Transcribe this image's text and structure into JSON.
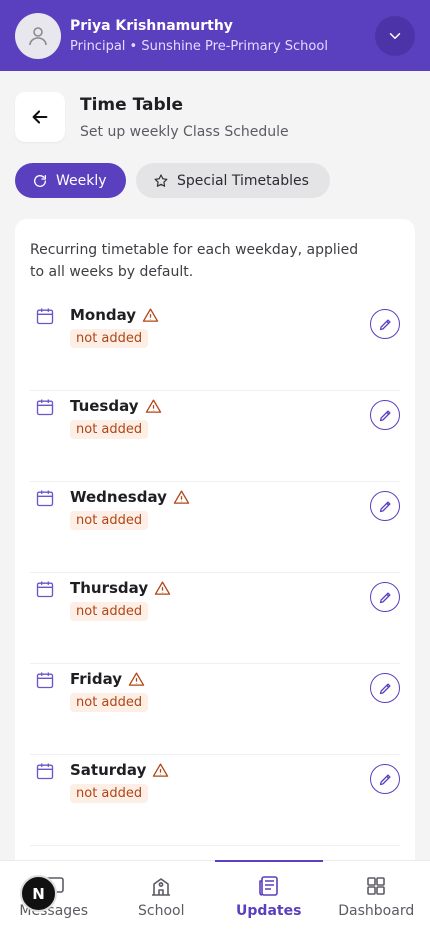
{
  "header": {
    "user_name": "Priya Krishnamurthy",
    "user_role": "Principal • Sunshine Pre-Primary School",
    "avatar_icon": "user-icon",
    "switch_icon": "chevron-down-icon",
    "bg_color": "#5a3fbf"
  },
  "page": {
    "title": "Time Table",
    "subtitle": "Set up weekly Class Schedule",
    "back_icon": "arrow-left-icon"
  },
  "tabs": [
    {
      "label": "Weekly",
      "icon": "refresh-icon",
      "active": true
    },
    {
      "label": "Special Timetables",
      "icon": "star-icon",
      "active": false
    }
  ],
  "card": {
    "description": "Recurring timetable for each weekday, applied to all weeks by default."
  },
  "days": [
    {
      "name": "Monday",
      "status": "not added"
    },
    {
      "name": "Tuesday",
      "status": "not added"
    },
    {
      "name": "Wednesday",
      "status": "not added"
    },
    {
      "name": "Thursday",
      "status": "not added"
    },
    {
      "name": "Friday",
      "status": "not added"
    },
    {
      "name": "Saturday",
      "status": "not added"
    }
  ],
  "bottom_nav": [
    {
      "label": "Messages",
      "icon": "message-icon",
      "active": false
    },
    {
      "label": "School",
      "icon": "school-icon",
      "active": false
    },
    {
      "label": "Updates",
      "icon": "newspaper-icon",
      "active": true
    },
    {
      "label": "Dashboard",
      "icon": "grid-icon",
      "active": false
    }
  ],
  "badge": {
    "letter": "N"
  },
  "colors": {
    "accent": "#5a3fbf",
    "warning": "#b14515",
    "warning_bg": "#fdeee6"
  }
}
